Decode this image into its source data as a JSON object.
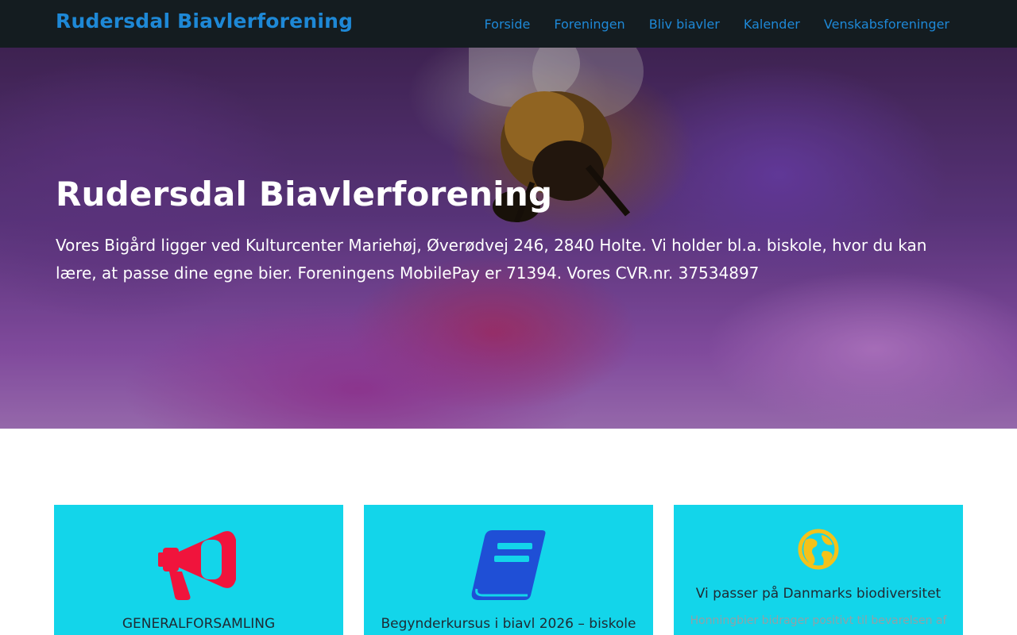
{
  "header": {
    "brand": "Rudersdal Biavlerforening",
    "nav": [
      "Forside",
      "Foreningen",
      "Bliv biavler",
      "Kalender",
      "Venskabsforeninger"
    ]
  },
  "hero": {
    "title": "Rudersdal Biavlerforening",
    "text": "Vores Bigård ligger ved Kulturcenter Mariehøj, Øverødvej 246, 2840 Holte. Vi holder bl.a. biskole, hvor du kan lære, at passe dine egne bier. Foreningens MobilePay er 71394. Vores CVR.nr. 37534897"
  },
  "cards": [
    {
      "icon": "megaphone-icon",
      "icon_color": "#f0143c",
      "title": "GENERALFORSAMLING",
      "subtitle": ""
    },
    {
      "icon": "book-icon",
      "icon_color": "#1f4fd6",
      "title": "Begynderkursus i biavl 2026 – biskole",
      "subtitle": ""
    },
    {
      "icon": "globe-icon",
      "icon_color": "#f4c21a",
      "title": "Vi passer på Danmarks biodiversitet",
      "subtitle": "Honningbier bidrager positivt til bevarelsen af"
    }
  ],
  "colors": {
    "navbar_bg": "#141c20",
    "link": "#1e88d6",
    "card_bg": "#13d5ea"
  }
}
